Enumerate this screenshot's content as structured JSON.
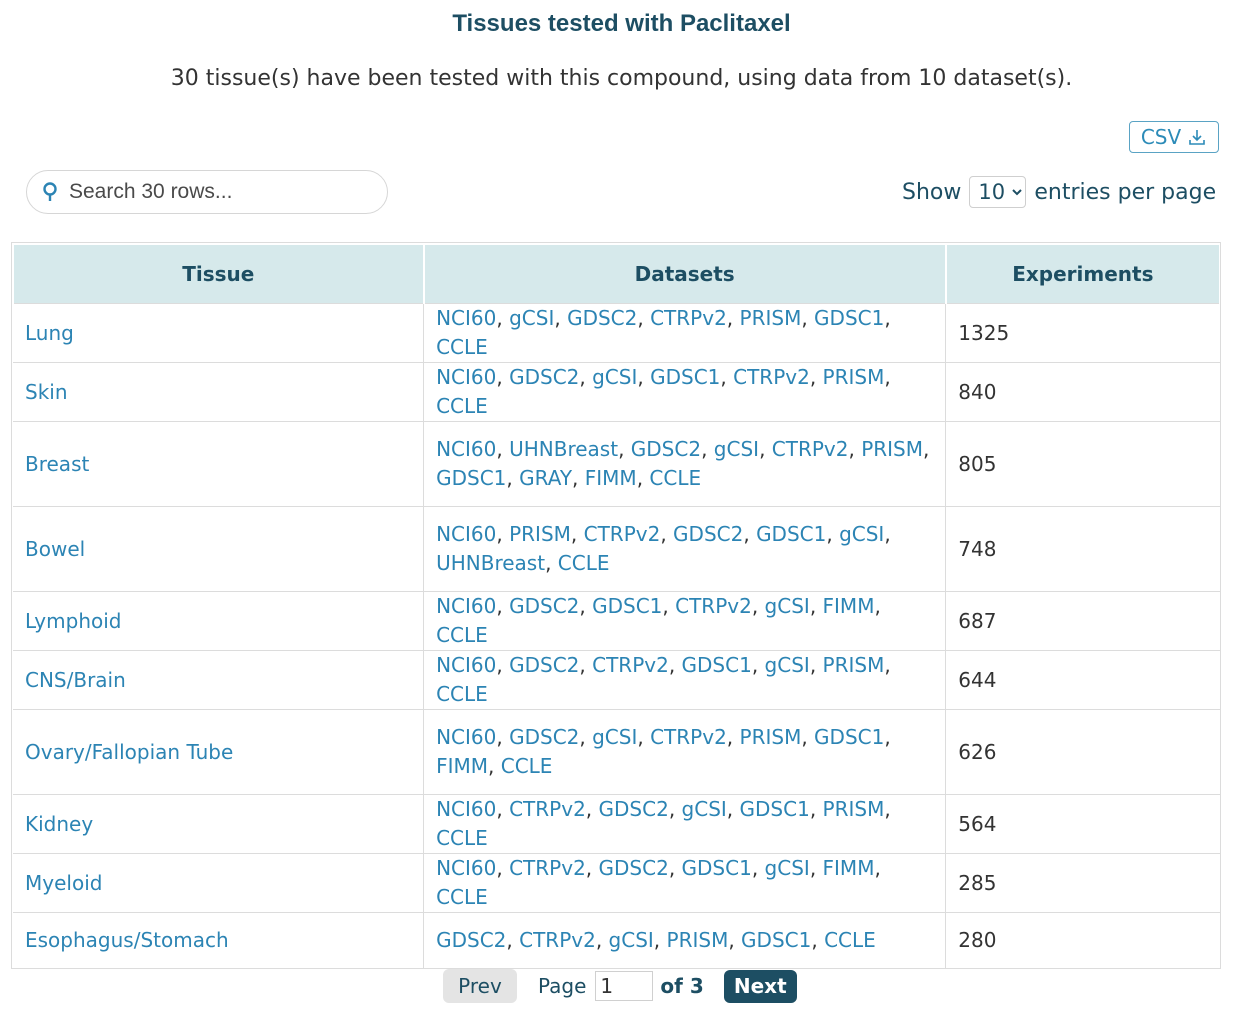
{
  "header": {
    "title": "Tissues tested with Paclitaxel",
    "subtitle": "30 tissue(s) have been tested with this compound, using data from 10 dataset(s)."
  },
  "toolbar": {
    "csv_label": "CSV",
    "search_placeholder": "Search 30 rows...",
    "show_label": "Show",
    "entries_value": "10",
    "entries_options": [
      "10"
    ],
    "entries_suffix": "entries per page"
  },
  "table": {
    "columns": [
      "Tissue",
      "Datasets",
      "Experiments"
    ],
    "rows": [
      {
        "tissue": "Lung",
        "datasets": [
          "NCI60",
          "gCSI",
          "GDSC2",
          "CTRPv2",
          "PRISM",
          "GDSC1",
          "CCLE"
        ],
        "experiments": "1325"
      },
      {
        "tissue": "Skin",
        "datasets": [
          "NCI60",
          "GDSC2",
          "gCSI",
          "GDSC1",
          "CTRPv2",
          "PRISM",
          "CCLE"
        ],
        "experiments": "840"
      },
      {
        "tissue": "Breast",
        "datasets": [
          "NCI60",
          "UHNBreast",
          "GDSC2",
          "gCSI",
          "CTRPv2",
          "PRISM",
          "GDSC1",
          "GRAY",
          "FIMM",
          "CCLE"
        ],
        "experiments": "805"
      },
      {
        "tissue": "Bowel",
        "datasets": [
          "NCI60",
          "PRISM",
          "CTRPv2",
          "GDSC2",
          "GDSC1",
          "gCSI",
          "UHNBreast",
          "CCLE"
        ],
        "experiments": "748"
      },
      {
        "tissue": "Lymphoid",
        "datasets": [
          "NCI60",
          "GDSC2",
          "GDSC1",
          "CTRPv2",
          "gCSI",
          "FIMM",
          "CCLE"
        ],
        "experiments": "687"
      },
      {
        "tissue": "CNS/Brain",
        "datasets": [
          "NCI60",
          "GDSC2",
          "CTRPv2",
          "GDSC1",
          "gCSI",
          "PRISM",
          "CCLE"
        ],
        "experiments": "644"
      },
      {
        "tissue": "Ovary/Fallopian Tube",
        "datasets": [
          "NCI60",
          "GDSC2",
          "gCSI",
          "CTRPv2",
          "PRISM",
          "GDSC1",
          "FIMM",
          "CCLE"
        ],
        "experiments": "626"
      },
      {
        "tissue": "Kidney",
        "datasets": [
          "NCI60",
          "CTRPv2",
          "GDSC2",
          "gCSI",
          "GDSC1",
          "PRISM",
          "CCLE"
        ],
        "experiments": "564"
      },
      {
        "tissue": "Myeloid",
        "datasets": [
          "NCI60",
          "CTRPv2",
          "GDSC2",
          "GDSC1",
          "gCSI",
          "FIMM",
          "CCLE"
        ],
        "experiments": "285"
      },
      {
        "tissue": "Esophagus/Stomach",
        "datasets": [
          "GDSC2",
          "CTRPv2",
          "gCSI",
          "PRISM",
          "GDSC1",
          "CCLE"
        ],
        "experiments": "280"
      }
    ]
  },
  "pagination": {
    "prev_label": "Prev",
    "page_label": "Page",
    "current_page": "1",
    "of_label": "of 3",
    "next_label": "Next"
  },
  "colors": {
    "brand_dark": "#1d4e63",
    "link": "#2c84b4",
    "header_bg": "#d6e9eb"
  }
}
